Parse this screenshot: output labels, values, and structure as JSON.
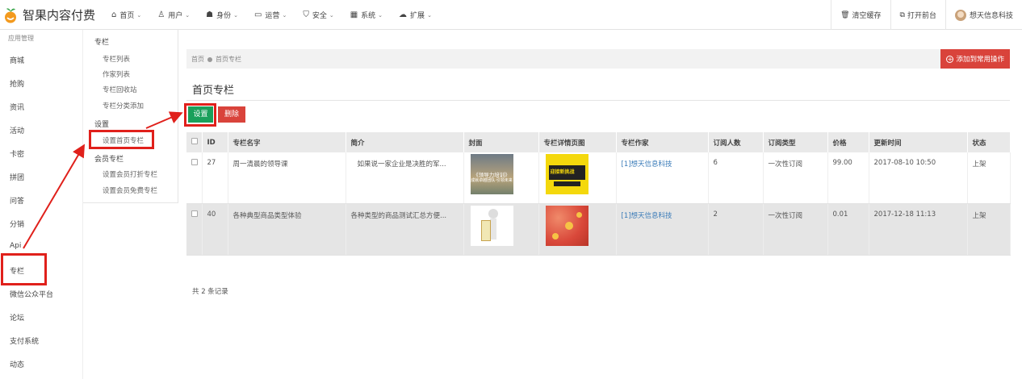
{
  "app": {
    "title": "智果内容付费"
  },
  "topnav": [
    {
      "icon": "home-icon",
      "glyph": "⌂",
      "label": "首页"
    },
    {
      "icon": "user-icon",
      "glyph": "♙",
      "label": "用户"
    },
    {
      "icon": "users-icon",
      "glyph": "☗",
      "label": "身份"
    },
    {
      "icon": "monitor-icon",
      "glyph": "▭",
      "label": "运营"
    },
    {
      "icon": "shield-icon",
      "glyph": "⛉",
      "label": "安全"
    },
    {
      "icon": "windows-icon",
      "glyph": "▦",
      "label": "系统"
    },
    {
      "icon": "cloud-icon",
      "glyph": "☁",
      "label": "扩展"
    }
  ],
  "topright": {
    "clear_cache": "清空缓存",
    "open_front": "打开前台",
    "user_name": "想天信息科技"
  },
  "sidebar": {
    "header": "应用管理",
    "items": [
      "商城",
      "抢购",
      "资讯",
      "活动",
      "卡密",
      "拼团",
      "问答",
      "分销",
      "Api",
      "专栏",
      "微信公众平台",
      "论坛",
      "支付系统",
      "动态"
    ]
  },
  "submenu": {
    "groups": [
      {
        "label": "专栏",
        "items": [
          "专栏列表",
          "作家列表",
          "专栏回收站",
          "专栏分类添加"
        ]
      },
      {
        "label": "设置",
        "items": [
          "设置首页专栏"
        ]
      },
      {
        "label": "会员专栏",
        "items": [
          "设置会员打折专栏",
          "设置会员免费专栏"
        ]
      }
    ]
  },
  "breadcrumb": {
    "home": "首页",
    "current": "首页专栏"
  },
  "add_common_button": "添加到常用操作",
  "page_title": "首页专栏",
  "actions": {
    "set": "设置",
    "delete": "删除"
  },
  "table": {
    "headers": [
      "ID",
      "专栏名字",
      "简介",
      "封面",
      "专栏详情页图",
      "专栏作家",
      "订阅人数",
      "订阅类型",
      "价格",
      "更新时间",
      "状态"
    ],
    "rows": [
      {
        "id": "27",
        "name": "周一清晨的领导课",
        "intro": "如果说一家企业是决胜的军...",
        "cover_text": "《领导力培训》",
        "cover_sub": "成就卓越团队·引领未来",
        "detail_text": "迎接新挑战",
        "author": "[1]想天信息科技",
        "subscribers": "6",
        "type": "一次性订阅",
        "price": "99.00",
        "updated": "2017-08-10 10:50",
        "status": "上架"
      },
      {
        "id": "40",
        "name": "各种典型商品类型体验",
        "intro": "各种类型的商品测试汇总方便...",
        "author": "[1]想天信息科技",
        "subscribers": "2",
        "type": "一次性订阅",
        "price": "0.01",
        "updated": "2017-12-18 11:13",
        "status": "上架"
      }
    ],
    "total": "共 2 条记录"
  },
  "colors": {
    "primary_green": "#1aa05b",
    "danger_red": "#d9433b",
    "annotation_red": "#e0201b",
    "link_blue": "#3a7bb8"
  }
}
